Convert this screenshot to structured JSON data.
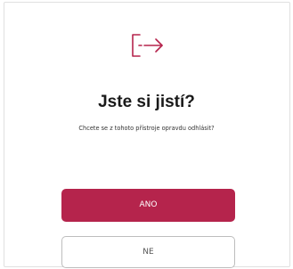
{
  "dialog": {
    "title": "Jste si jistí?",
    "message": "Chcete se z tohoto přístroje opravdu odhlásit?",
    "icon": "logout-icon",
    "confirm_label": "ANO",
    "cancel_label": "NE"
  },
  "colors": {
    "accent": "#b5244c",
    "title_text": "#1a1a1a",
    "border": "#bdbdbd"
  }
}
